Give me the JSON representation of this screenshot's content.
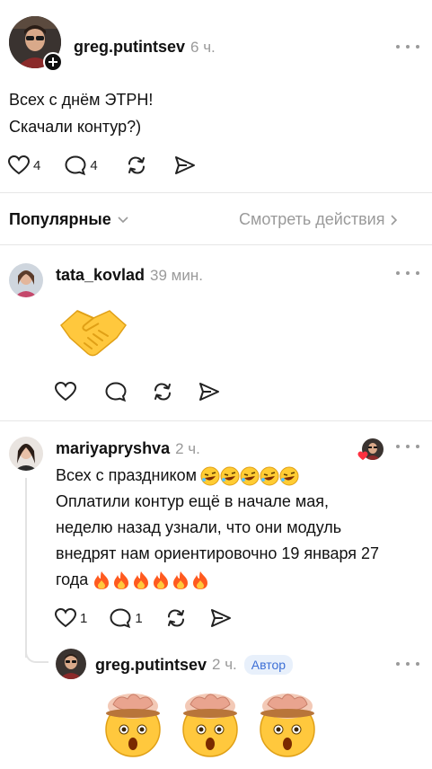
{
  "post": {
    "username": "greg.putintsev",
    "time": "6 ч.",
    "lines": [
      "Всех с днём ЭТРН!",
      "Скачали контур?)"
    ],
    "likes": "4",
    "comments": "4"
  },
  "filter": {
    "label": "Популярные",
    "view_actions": "Смотреть действия"
  },
  "replies": [
    {
      "username": "tata_kovlad",
      "time": "39 мин.",
      "emoji": "handshake"
    },
    {
      "username": "mariyapryshva",
      "time": "2 ч.",
      "lines": [
        "Всех с праздником",
        "Оплатили контур ещё в начале мая,",
        "неделю назад узнали, что они модуль",
        "внедрят нам ориентировочно 19 января 27",
        "года"
      ],
      "likes": "1",
      "comments": "1"
    },
    {
      "username": "greg.putintsev",
      "time": "2 ч.",
      "badge": "Автор",
      "emoji": "exploding-head"
    }
  ],
  "colors": {
    "accent_badge_bg": "#e8f0fb",
    "accent_badge_text": "#3d6fd6",
    "muted": "#9a9a9a",
    "divider": "#e6e6e6"
  }
}
